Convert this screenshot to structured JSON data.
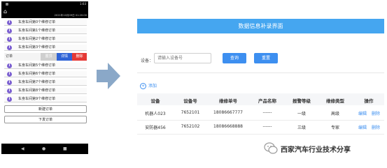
{
  "phone": {
    "time": "1:03",
    "datetime": "2021年10月09日 01:20:00",
    "rows_top": [
      "车身车间第0个维修订单",
      "车身车间第1个维修订单",
      "车身车间第2个维修订单",
      "车身车间第3个维修订单"
    ],
    "swipe_row": {
      "label": "订单",
      "buttons": [
        "置顶",
        "详情",
        "删除"
      ]
    },
    "rows_bottom": [
      "车身车间第5个维修订单",
      "车身车间第6个维修订单",
      "车身车间第7个维修订单",
      "车身车间第8个维修订单",
      "车身车间第9个维修订单"
    ],
    "new_order_label": "新建订单",
    "download_label": "下发订单"
  },
  "web": {
    "title": "数据信息补录界面",
    "search_label": "设备：",
    "search_placeholder": "请输入设备号",
    "query_label": "查询",
    "reset_label": "重置",
    "add_label": "添加",
    "columns": [
      "设备",
      "设备号",
      "维修单号",
      "产品名称",
      "报警等级",
      "维修类型",
      "操作"
    ],
    "rows": [
      {
        "device": "机器人023",
        "device_no": "7652101",
        "order_no": "18086667777",
        "product": "------",
        "level": "一级",
        "type": "高级",
        "edit": "编辑",
        "delete": "删除"
      },
      {
        "device": "安防器456",
        "device_no": "7652102",
        "order_no": "18086668888",
        "product": "------",
        "level": "三级",
        "type": "专家",
        "edit": "编辑",
        "delete": "删除"
      }
    ]
  },
  "watermark": "西家汽车行业技术分享",
  "colors": {
    "accent": "#45a6f0",
    "button": "#3d8ff0",
    "danger": "#e53935",
    "phone_icon": "#7b5fd1"
  }
}
